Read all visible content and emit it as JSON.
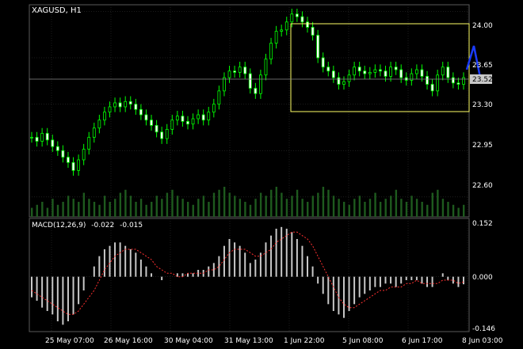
{
  "symbol_label": "XAGUSD, H1",
  "macd": {
    "label": "MACD(12,26,9)",
    "main_value": "-0.022",
    "signal_value": "-0.015"
  },
  "price_scale": [
    "24.00",
    "23.65",
    "23.30",
    "22.95",
    "22.60"
  ],
  "current_price": "23.52",
  "macd_scale": [
    "0.152",
    "0.000",
    "-0.146"
  ],
  "time_labels": [
    "25 May 07:00",
    "26 May 16:00",
    "30 May 04:00",
    "31 May 13:00",
    "1 Jun 22:00",
    "5 Jun 08:00",
    "6 Jun 17:00",
    "8 Jun 03:00"
  ],
  "colors": {
    "background": "#000000",
    "candle": "#00ff00",
    "grid": "#3a3a3a",
    "highlight_box": "#ffff66",
    "forecast_line": "#1a3cff",
    "signal_line": "#ff3030"
  },
  "chart_data": {
    "type": "line",
    "price_ylim": [
      22.45,
      24.05
    ],
    "macd_ylim": [
      -0.16,
      0.17
    ],
    "series": [
      {
        "values": [
          23.05,
          23.02,
          23.08,
          23.03,
          22.98,
          22.95,
          22.9,
          22.86,
          22.8,
          22.88,
          22.96,
          23.05,
          23.12,
          23.18,
          23.24,
          23.28,
          23.31,
          23.28,
          23.32,
          23.3,
          23.26,
          23.22,
          23.18,
          23.14,
          23.09,
          23.04,
          23.11,
          23.18,
          23.21,
          23.17,
          23.15,
          23.19,
          23.22,
          23.18,
          23.24,
          23.3,
          23.4,
          23.5,
          23.55,
          23.54,
          23.58,
          23.53,
          23.42,
          23.38,
          23.52,
          23.64,
          23.76,
          23.85,
          23.86,
          23.92,
          23.98,
          23.96,
          23.92,
          23.88,
          23.82,
          23.65,
          23.58,
          23.55,
          23.5,
          23.45,
          23.47,
          23.52,
          23.58,
          23.55,
          23.53,
          23.54,
          23.56,
          23.55,
          23.51,
          23.58,
          23.56,
          23.5,
          23.48,
          23.53,
          23.56,
          23.51,
          23.45,
          23.4,
          23.52,
          23.58,
          23.5,
          23.46,
          23.45,
          23.5
        ]
      },
      {
        "name": "MACD(12,26,9)",
        "values": [
          -0.06,
          -0.07,
          -0.09,
          -0.1,
          -0.11,
          -0.13,
          -0.14,
          -0.13,
          -0.11,
          -0.08,
          -0.04,
          0.0,
          0.03,
          0.06,
          0.08,
          0.09,
          0.1,
          0.1,
          0.09,
          0.08,
          0.07,
          0.05,
          0.03,
          0.01,
          0.0,
          -0.01,
          0.0,
          0.0,
          0.01,
          0.01,
          0.01,
          0.01,
          0.02,
          0.02,
          0.03,
          0.04,
          0.06,
          0.09,
          0.11,
          0.1,
          0.09,
          0.07,
          0.04,
          0.05,
          0.07,
          0.1,
          0.12,
          0.14,
          0.145,
          0.14,
          0.13,
          0.11,
          0.09,
          0.06,
          0.03,
          -0.02,
          -0.05,
          -0.08,
          -0.1,
          -0.11,
          -0.12,
          -0.1,
          -0.08,
          -0.06,
          -0.05,
          -0.04,
          -0.03,
          -0.03,
          -0.02,
          -0.02,
          -0.03,
          -0.02,
          -0.01,
          -0.01,
          -0.01,
          -0.02,
          -0.03,
          -0.03,
          0.0,
          0.01,
          -0.01,
          -0.02,
          -0.03,
          -0.022
        ]
      },
      {
        "name": "signal",
        "values": [
          -0.04,
          -0.05,
          -0.06,
          -0.07,
          -0.08,
          -0.09,
          -0.1,
          -0.11,
          -0.11,
          -0.1,
          -0.08,
          -0.06,
          -0.04,
          -0.01,
          0.02,
          0.04,
          0.06,
          0.07,
          0.08,
          0.08,
          0.08,
          0.07,
          0.06,
          0.05,
          0.03,
          0.02,
          0.01,
          0.01,
          0.0,
          0.0,
          0.01,
          0.01,
          0.01,
          0.01,
          0.02,
          0.02,
          0.03,
          0.05,
          0.07,
          0.08,
          0.08,
          0.08,
          0.07,
          0.06,
          0.06,
          0.07,
          0.08,
          0.1,
          0.11,
          0.12,
          0.13,
          0.13,
          0.12,
          0.11,
          0.09,
          0.06,
          0.03,
          0.0,
          -0.03,
          -0.06,
          -0.08,
          -0.09,
          -0.09,
          -0.08,
          -0.07,
          -0.06,
          -0.05,
          -0.04,
          -0.04,
          -0.03,
          -0.03,
          -0.03,
          -0.02,
          -0.02,
          -0.01,
          -0.02,
          -0.02,
          -0.02,
          -0.02,
          -0.01,
          -0.01,
          -0.01,
          -0.02,
          -0.015
        ]
      }
    ],
    "volume": [
      3,
      4,
      5,
      3,
      6,
      4,
      5,
      7,
      6,
      5,
      8,
      6,
      5,
      4,
      7,
      5,
      6,
      8,
      9,
      7,
      5,
      6,
      4,
      5,
      7,
      6,
      8,
      9,
      7,
      6,
      5,
      4,
      6,
      7,
      5,
      8,
      9,
      10,
      8,
      7,
      6,
      5,
      4,
      6,
      8,
      7,
      9,
      10,
      8,
      6,
      7,
      9,
      6,
      5,
      7,
      8,
      10,
      9,
      7,
      6,
      5,
      4,
      6,
      7,
      5,
      6,
      8,
      5,
      6,
      7,
      9,
      6,
      5,
      7,
      6,
      5,
      4,
      8,
      9,
      6,
      5,
      4,
      3,
      4
    ]
  }
}
